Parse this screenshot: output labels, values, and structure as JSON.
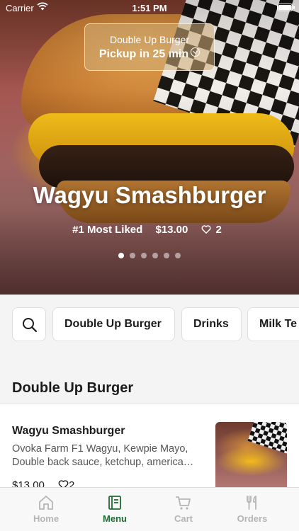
{
  "status_bar": {
    "carrier": "Carrier",
    "time": "1:51 PM"
  },
  "pickup": {
    "store": "Double Up Burger",
    "eta": "Pickup in 25 min"
  },
  "hero": {
    "title": "Wagyu Smashburger",
    "badge": "#1 Most Liked",
    "price": "$13.00",
    "likes": "2",
    "page_count": 6,
    "active_page": 1
  },
  "categories": [
    "Double Up Burger",
    "Drinks",
    "Milk Te"
  ],
  "section": {
    "title": "Double Up Burger",
    "items": [
      {
        "name": "Wagyu Smashburger",
        "description": "Ovoka Farm F1 Wagyu, Kewpie Mayo, Double back sauce, ketchup, america…",
        "price": "$13.00",
        "likes": "2"
      }
    ]
  },
  "tabs": [
    {
      "label": "Home",
      "icon": "home-icon",
      "active": false
    },
    {
      "label": "Menu",
      "icon": "menu-icon",
      "active": true
    },
    {
      "label": "Cart",
      "icon": "cart-icon",
      "active": false
    },
    {
      "label": "Orders",
      "icon": "utensils-icon",
      "active": false
    }
  ],
  "colors": {
    "accent": "#1f6b33",
    "inactive_tab": "#b5b5b5"
  }
}
